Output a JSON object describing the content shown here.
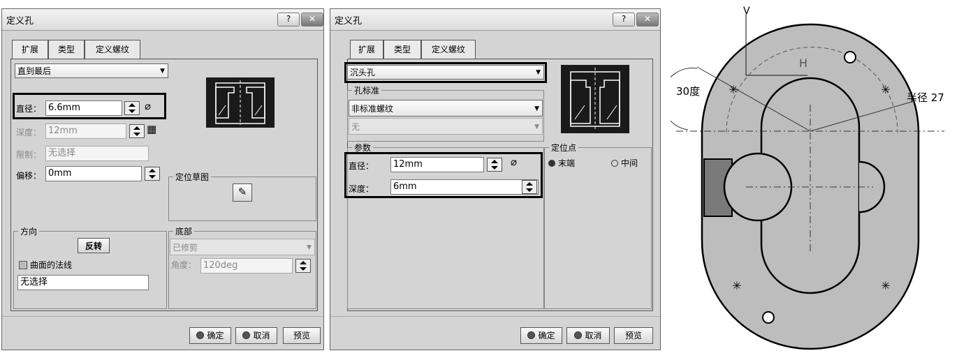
{
  "dialog1": {
    "title": "定义孔",
    "help_label": "?",
    "close_label": "✕",
    "tabs": [
      "扩展",
      "类型",
      "定义螺纹"
    ],
    "extension_type": "直到最后",
    "diameter_label": "直径：",
    "diameter_value": "6.6mm",
    "depth_label": "深度：",
    "depth_value": "12mm",
    "limit_label": "限制：",
    "limit_value": "无选择",
    "offset_label": "偏移：",
    "offset_value": "0mm",
    "sketch_group": "定位草图",
    "direction_group": "方向",
    "reverse_label": "反转",
    "normal_label": "曲面的法线",
    "normal_value": "无选择",
    "bottom_group": "底部",
    "bottom_type": "已修剪",
    "angle_label": "角度：",
    "angle_value": "120deg",
    "ok_label": "确定",
    "cancel_label": "取消",
    "preview_label": "预览"
  },
  "dialog2": {
    "title": "定义孔",
    "help_label": "?",
    "close_label": "✕",
    "tabs": [
      "扩展",
      "类型",
      "定义螺纹"
    ],
    "hole_type": "沉头孔",
    "standard_group": "孔标准",
    "standard_value": "非标准螺纹",
    "standard_sub": "无",
    "params_group": "参数",
    "diameter_label": "直径：",
    "diameter_value": "12mm",
    "depth_label": "深度：",
    "depth_value": "6mm",
    "anchor_group": "定位点",
    "anchor_end": "末端",
    "anchor_middle": "中间",
    "ok_label": "确定",
    "cancel_label": "取消",
    "preview_label": "预览"
  },
  "drawing": {
    "v_label": "V",
    "h_label": "H",
    "angle_label": "30度",
    "radius_label": "半径 27"
  }
}
